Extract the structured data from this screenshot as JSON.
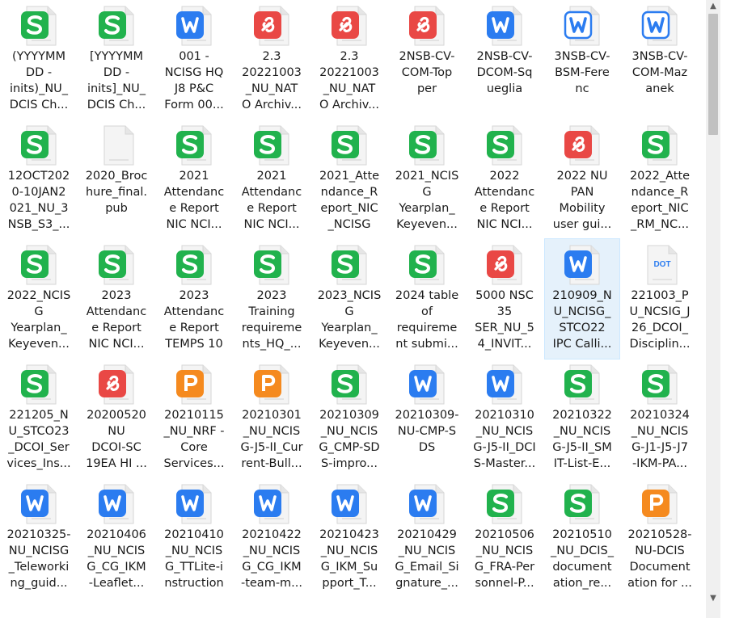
{
  "colors": {
    "sheet": "#21b24d",
    "word": "#2b7cf0",
    "pdf": "#e94845",
    "ppt": "#f58a1f",
    "blank": "#ffffff",
    "dot": "#2b7cf0",
    "selection": "#e5f1fb"
  },
  "files": [
    {
      "label": "(YYYYMM\nDD -\ninits)_NU_\nDCIS Ch...",
      "icon": "sheet-icon",
      "type": "sheet"
    },
    {
      "label": "[YYYYMM\nDD -\ninits]_NU_\nDCIS Ch...",
      "icon": "sheet-icon",
      "type": "sheet"
    },
    {
      "label": "001 -\nNCISG HQ\nJ8 P&C\nForm 00...",
      "icon": "word-icon",
      "type": "word"
    },
    {
      "label": "2.3\n20221003\n_NU_NAT\nO Archiv...",
      "icon": "pdf-icon",
      "type": "pdf"
    },
    {
      "label": "2.3\n20221003\n_NU_NAT\nO Archiv...",
      "icon": "pdf-icon",
      "type": "pdf"
    },
    {
      "label": "2NSB-CV-\nCOM-Top\nper",
      "icon": "pdf-icon",
      "type": "pdf"
    },
    {
      "label": "2NSB-CV-\nDCOM-Sq\nueglia",
      "icon": "word-icon",
      "type": "word"
    },
    {
      "label": "3NSB-CV-\nBSM-Fere\nnc",
      "icon": "word-outline-icon",
      "type": "wordo"
    },
    {
      "label": "3NSB-CV-\nCOM-Maz\nanek",
      "icon": "word-outline-icon",
      "type": "wordo"
    },
    {
      "label": "12OCT202\n0-10JAN2\n021_NU_3\nNSB_S3_...",
      "icon": "sheet-icon",
      "type": "sheet"
    },
    {
      "label": "2020_Broc\nhure_final.\npub",
      "icon": "blank-file-icon",
      "type": "blank"
    },
    {
      "label": "2021\nAttendanc\ne Report\nNIC NCI...",
      "icon": "sheet-icon",
      "type": "sheet"
    },
    {
      "label": "2021\nAttendanc\ne Report\nNIC NCI...",
      "icon": "sheet-icon",
      "type": "sheet"
    },
    {
      "label": "2021_Atte\nndance_R\neport_NIC\n_NCISG",
      "icon": "sheet-icon",
      "type": "sheet"
    },
    {
      "label": "2021_NCIS\nG\nYearplan_\nKeyeven...",
      "icon": "sheet-icon",
      "type": "sheet"
    },
    {
      "label": "2022\nAttendanc\ne Report\nNIC NCI...",
      "icon": "sheet-icon",
      "type": "sheet"
    },
    {
      "label": "2022 NU\nPAN\nMobility\nuser gui...",
      "icon": "pdf-icon",
      "type": "pdf"
    },
    {
      "label": "2022_Atte\nndance_R\neport_NIC\n_RM_NC...",
      "icon": "sheet-icon",
      "type": "sheet"
    },
    {
      "label": "2022_NCIS\nG\nYearplan_\nKeyeven...",
      "icon": "sheet-icon",
      "type": "sheet"
    },
    {
      "label": "2023\nAttendanc\ne Report\nNIC NCI...",
      "icon": "sheet-icon",
      "type": "sheet"
    },
    {
      "label": "2023\nAttendanc\ne Report\nTEMPS 10",
      "icon": "sheet-icon",
      "type": "sheet"
    },
    {
      "label": "2023\nTraining\nrequireme\nnts_HQ_...",
      "icon": "sheet-icon",
      "type": "sheet"
    },
    {
      "label": "2023_NCIS\nG\nYearplan_\nKeyeven...",
      "icon": "sheet-icon",
      "type": "sheet"
    },
    {
      "label": "2024 table\nof\nrequireme\nnt submi...",
      "icon": "sheet-icon",
      "type": "sheet"
    },
    {
      "label": "5000 NSC\n35\nSER_NU_5\n4_INVIT...",
      "icon": "pdf-icon",
      "type": "pdf"
    },
    {
      "label": "210909_N\nU_NCISG_\nSTCO22\nIPC Calli...",
      "icon": "word-icon",
      "type": "word",
      "selected": true
    },
    {
      "label": "221003_P\nU_NCSIG_J\n26_DCOI_\nDisciplin...",
      "icon": "dot-file-icon",
      "type": "dot",
      "badge": "DOT"
    },
    {
      "label": "221205_N\nU_STCO23\n_DCOI_Ser\nvices_Ins...",
      "icon": "sheet-icon",
      "type": "sheet"
    },
    {
      "label": "20200520\nNU\nDCOI-SC\n19EA HI ...",
      "icon": "pdf-icon",
      "type": "pdf"
    },
    {
      "label": "20210115\n_NU_NRF -\nCore\nServices...",
      "icon": "ppt-icon",
      "type": "ppt"
    },
    {
      "label": "20210301\n_NU_NCIS\nG-J5-II_Cur\nrent-Bull...",
      "icon": "ppt-icon",
      "type": "ppt"
    },
    {
      "label": "20210309\n_NU_NCIS\nG_CMP-SD\nS-impro...",
      "icon": "sheet-icon",
      "type": "sheet"
    },
    {
      "label": "20210309-\nNU-CMP-S\nDS",
      "icon": "word-icon",
      "type": "word"
    },
    {
      "label": "20210310\n_NU_NCIS\nG-J5-II_DCI\nS-Master...",
      "icon": "word-icon",
      "type": "word"
    },
    {
      "label": "20210322\n_NU_NCIS\nG-J5-II_SM\nIT-List-E...",
      "icon": "sheet-icon",
      "type": "sheet"
    },
    {
      "label": "20210324\n_NU_NCIS\nG-J1-J5-J7\n-IKM-PA...",
      "icon": "sheet-icon",
      "type": "sheet"
    },
    {
      "label": "20210325-\nNU_NCISG\n_Teleworki\nng_guid...",
      "icon": "word-icon",
      "type": "word"
    },
    {
      "label": "20210406\n_NU_NCIS\nG_CG_IKM\n-Leaflet...",
      "icon": "word-icon",
      "type": "word"
    },
    {
      "label": "20210410\n_NU_NCIS\nG_TTLite-i\nnstruction",
      "icon": "word-icon",
      "type": "word"
    },
    {
      "label": "20210422\n_NU_NCIS\nG_CG_IKM\n-team-m...",
      "icon": "word-icon",
      "type": "word"
    },
    {
      "label": "20210423\n_NU_NCIS\nG_IKM_Su\npport_T...",
      "icon": "word-icon",
      "type": "word"
    },
    {
      "label": "20210429\n_NU_NCIS\nG_Email_Si\ngnature_...",
      "icon": "word-icon",
      "type": "word"
    },
    {
      "label": "20210506\n_NU_NCIS\nG_FRA-Per\nsonnel-P...",
      "icon": "sheet-icon",
      "type": "sheet"
    },
    {
      "label": "20210510\n_NU_DCIS_\ndocument\nation_re...",
      "icon": "sheet-icon",
      "type": "sheet"
    },
    {
      "label": "20210528-\nNU-DCIS\nDocument\nation for ...",
      "icon": "ppt-icon",
      "type": "ppt"
    }
  ],
  "scrollbar": {
    "up_arrow": "▲",
    "down_arrow": "▼"
  }
}
